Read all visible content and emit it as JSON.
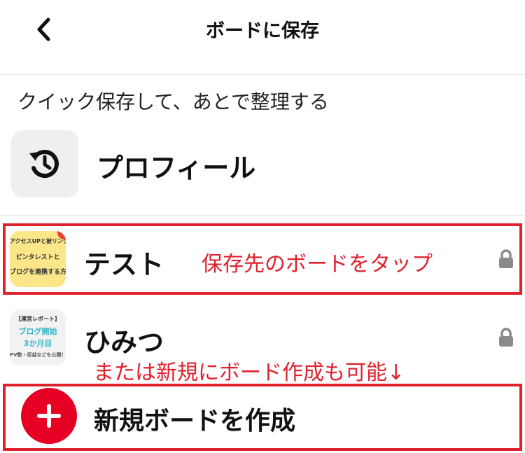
{
  "header": {
    "title": "ボードに保存",
    "back_icon": "chevron-left-icon"
  },
  "quick_save": {
    "label": "クイック保存して、あとで整理する",
    "profile_label": "プロフィール",
    "icon": "history-icon"
  },
  "boards": [
    {
      "name": "テスト",
      "locked": true,
      "thumb_lines": [
        "アクセスUPと被リンク獲得",
        "ピンタレストと",
        "ブログを連携する方"
      ]
    },
    {
      "name": "ひみつ",
      "locked": true,
      "thumb_lines": [
        "【運営レポート】",
        "ブログ開始",
        "3か月目",
        "PV数・収益なども公開！"
      ]
    }
  ],
  "annotations": {
    "tap_board": "保存先のボードをタップ",
    "or_create": "または新規にボード作成も可能↓"
  },
  "create": {
    "label": "新規ボードを作成",
    "icon": "plus-icon"
  },
  "colors": {
    "accent": "#e60023",
    "annotation": "#e0212d",
    "icon_bg": "#efefef"
  }
}
